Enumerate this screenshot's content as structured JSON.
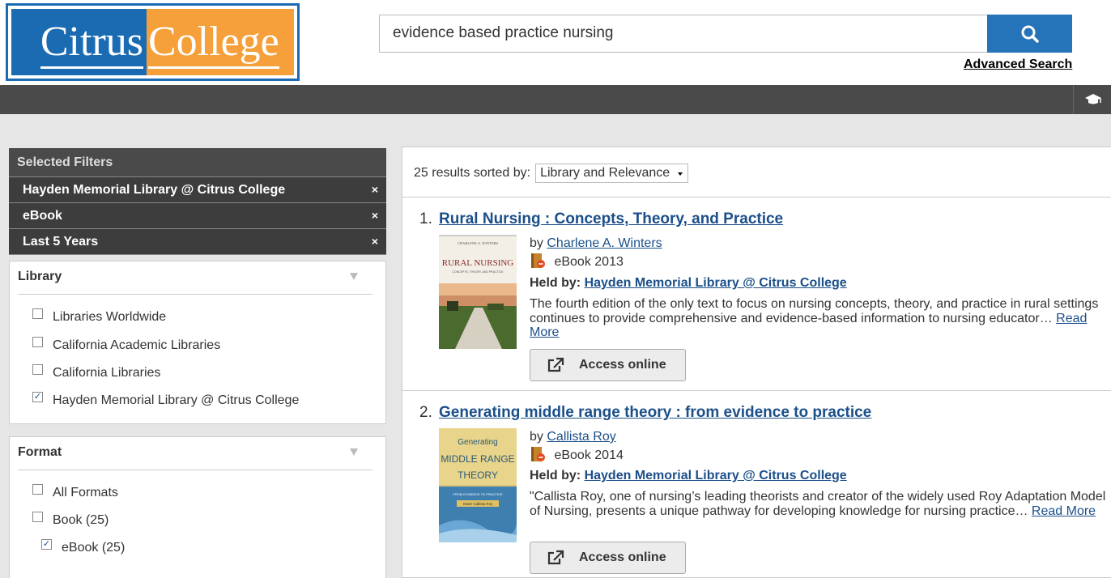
{
  "header": {
    "logo_part1": "Citrus",
    "logo_part2": "College",
    "search_value": "evidence based practice nursing",
    "advanced_search": "Advanced Search"
  },
  "colors": {
    "brand_blue": "#1b6bb3",
    "brand_orange": "#f6a03b",
    "link": "#1b4f8a",
    "search_button": "#2573b8"
  },
  "selected_filters": {
    "title": "Selected Filters",
    "items": [
      {
        "label": "Hayden Memorial Library @ Citrus College",
        "remove": "×"
      },
      {
        "label": "eBook",
        "remove": "×"
      },
      {
        "label": "Last 5 Years",
        "remove": "×"
      }
    ]
  },
  "library_facet": {
    "title": "Library",
    "options": [
      {
        "label": "Libraries Worldwide",
        "checked": false
      },
      {
        "label": "California Academic Libraries",
        "checked": false
      },
      {
        "label": "California Libraries",
        "checked": false
      },
      {
        "label": "Hayden Memorial Library @ Citrus College",
        "checked": true
      }
    ]
  },
  "format_facet": {
    "title": "Format",
    "options": [
      {
        "label": "All Formats",
        "checked": false
      },
      {
        "label": "Book (25)",
        "checked": false
      },
      {
        "label": "eBook (25)",
        "checked": true
      }
    ]
  },
  "results": {
    "summary": "25 results sorted by:",
    "sort_value": "Library and Relevance",
    "items": [
      {
        "num": "1.",
        "title": "Rural Nursing : Concepts, Theory, and Practice",
        "by": "by",
        "author": "Charlene A. Winters",
        "format": "eBook",
        "year": "2013",
        "held_label": "Held by:",
        "held_by": "Hayden Memorial Library @ Citrus College",
        "description": "The fourth edition of the only text to focus on nursing concepts, theory, and practice in rural settings continues to provide comprehensive and evidence-based information to nursing educator…",
        "read_more": "Read More",
        "access": "Access online",
        "cover_author": "CHARLENE A. WINTERS",
        "cover_title": "RURAL NURSING",
        "cover_sub": "CONCEPTS, THEORY, AND PRACTICE"
      },
      {
        "num": "2.",
        "title": "Generating middle range theory : from evidence to practice",
        "by": "by",
        "author": "Callista Roy",
        "format": "eBook",
        "year": "2014",
        "held_label": "Held by:",
        "held_by": "Hayden Memorial Library @ Citrus College",
        "description": "\"Callista Roy, one of nursing’s leading theorists and creator of the widely used Roy Adaptation Model of Nursing, presents a unique pathway for developing knowledge for nursing practice…",
        "read_more": "Read More",
        "access": "Access online",
        "cover_title1": "Generating",
        "cover_title2": "MIDDLE RANGE",
        "cover_title3": "THEORY",
        "cover_sub": "FROM EVIDENCE TO PRACTICE",
        "cover_author": "Sister Callista Roy"
      }
    ]
  }
}
